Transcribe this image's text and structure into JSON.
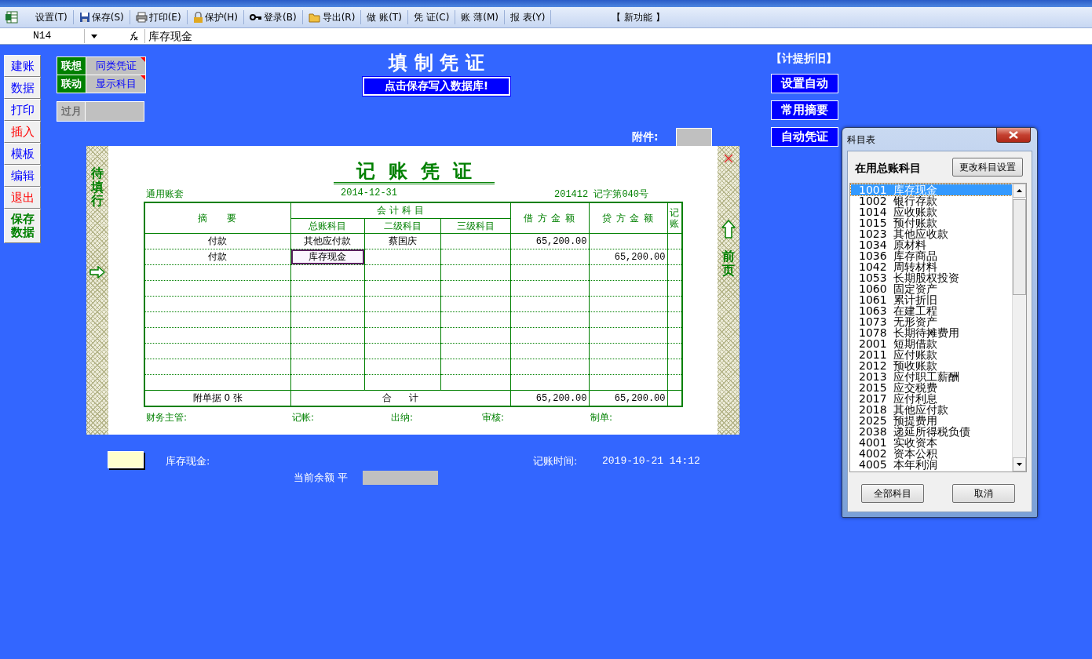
{
  "toolbar": {
    "items": [
      {
        "label": "设置(T)"
      },
      {
        "label": "保存(S)"
      },
      {
        "label": "打印(E)"
      },
      {
        "label": "保护(H)"
      },
      {
        "label": "登录(B)"
      },
      {
        "label": "导出(R)"
      },
      {
        "label": "做 账(T)"
      },
      {
        "label": "凭 证(C)"
      },
      {
        "label": "账 薄(M)"
      },
      {
        "label": "报 表(Y)"
      },
      {
        "label": "【 新功能 】"
      }
    ]
  },
  "formula_bar": {
    "cell": "N14",
    "value": "库存现金"
  },
  "side_buttons": [
    {
      "label": "建账",
      "color": "#0000ff"
    },
    {
      "label": "数据",
      "color": "#0000ff"
    },
    {
      "label": "打印",
      "color": "#0000ff"
    },
    {
      "label": "插入",
      "color": "#ff0000"
    },
    {
      "label": "模板",
      "color": "#0000ff"
    },
    {
      "label": "编辑",
      "color": "#0000ff"
    },
    {
      "label": "退出",
      "color": "#ff0000"
    },
    {
      "label": "保存数据",
      "color": "#008000"
    }
  ],
  "link_options": [
    {
      "tag": "联想",
      "label": "同类凭证"
    },
    {
      "tag": "联动",
      "label": "显示科目"
    }
  ],
  "month_close": {
    "tag": "过月",
    "disabled": true
  },
  "header": {
    "title": "填 制 凭 证",
    "save_banner": "点击保存写入数据库!"
  },
  "right_panel": {
    "heading": "【计提折旧】",
    "buttons": [
      "设置自动",
      "常用摘要",
      "自动凭证"
    ]
  },
  "attachment": {
    "label": "附件:"
  },
  "voucher": {
    "left_label": "待填行",
    "right_label": "前页",
    "title": "记  账  凭  证",
    "account_set": "通用账套",
    "date": "2014-12-31",
    "number": "201412 记字第040号",
    "columns": {
      "summary": "摘     要",
      "accounts": "会 计 科 目",
      "gl": "总账科目",
      "level2": "二级科目",
      "level3": "三级科目",
      "debit": "借 方 金 额",
      "credit": "贷 方 金 额",
      "posted": "记账"
    },
    "rows": [
      {
        "summary": "付款",
        "gl": "其他应付款",
        "level2": "蔡国庆",
        "debit": "65,200.00",
        "selected": false
      },
      {
        "summary": "付款",
        "gl": "库存现金",
        "credit": "65,200.00",
        "selected": true
      }
    ],
    "totals": {
      "attachments": "附单据 0 张",
      "label": "合      计",
      "debit": "65,200.00",
      "credit": "65,200.00"
    },
    "signatures": [
      "财务主管:",
      "记帐:",
      "出纳:",
      "审核:",
      "制单:"
    ]
  },
  "bottom": {
    "account": "库存现金:",
    "balance_label": "当前余额 平",
    "time_label": "记账时间:",
    "time": "2019-10-21 14:12"
  },
  "dialog": {
    "title": "科目表",
    "heading": "在用总账科目",
    "settings_button": "更改科目设置",
    "accounts": [
      {
        "label": "1001 库存现金",
        "selected": true
      },
      {
        "label": "1002 银行存款",
        "selected": false
      },
      {
        "label": "1014 应收账款",
        "selected": false
      },
      {
        "label": "1015 预付账款",
        "selected": false
      },
      {
        "label": "1023 其他应收款",
        "selected": false
      },
      {
        "label": "1034 原材料",
        "selected": false
      },
      {
        "label": "1036 库存商品",
        "selected": false
      },
      {
        "label": "1042 周转材料",
        "selected": false
      },
      {
        "label": "1053 长期股权投资",
        "selected": false
      },
      {
        "label": "1060 固定资产",
        "selected": false
      },
      {
        "label": "1061 累计折旧",
        "selected": false
      },
      {
        "label": "1063 在建工程",
        "selected": false
      },
      {
        "label": "1073 无形资产",
        "selected": false
      },
      {
        "label": "1078 长期待摊费用",
        "selected": false
      },
      {
        "label": "2001 短期借款",
        "selected": false
      },
      {
        "label": "2011 应付账款",
        "selected": false
      },
      {
        "label": "2012 预收账款",
        "selected": false
      },
      {
        "label": "2013 应付职工薪酬",
        "selected": false
      },
      {
        "label": "2015 应交税费",
        "selected": false
      },
      {
        "label": "2017 应付利息",
        "selected": false
      },
      {
        "label": "2018 其他应付款",
        "selected": false
      },
      {
        "label": "2025 预提费用",
        "selected": false
      },
      {
        "label": "2038 递延所得税负债",
        "selected": false
      },
      {
        "label": "4001 实收资本",
        "selected": false
      },
      {
        "label": "4002 资本公积",
        "selected": false
      },
      {
        "label": "4005 本年利润",
        "selected": false
      }
    ],
    "buttons": [
      "全部科目",
      "取消"
    ]
  }
}
